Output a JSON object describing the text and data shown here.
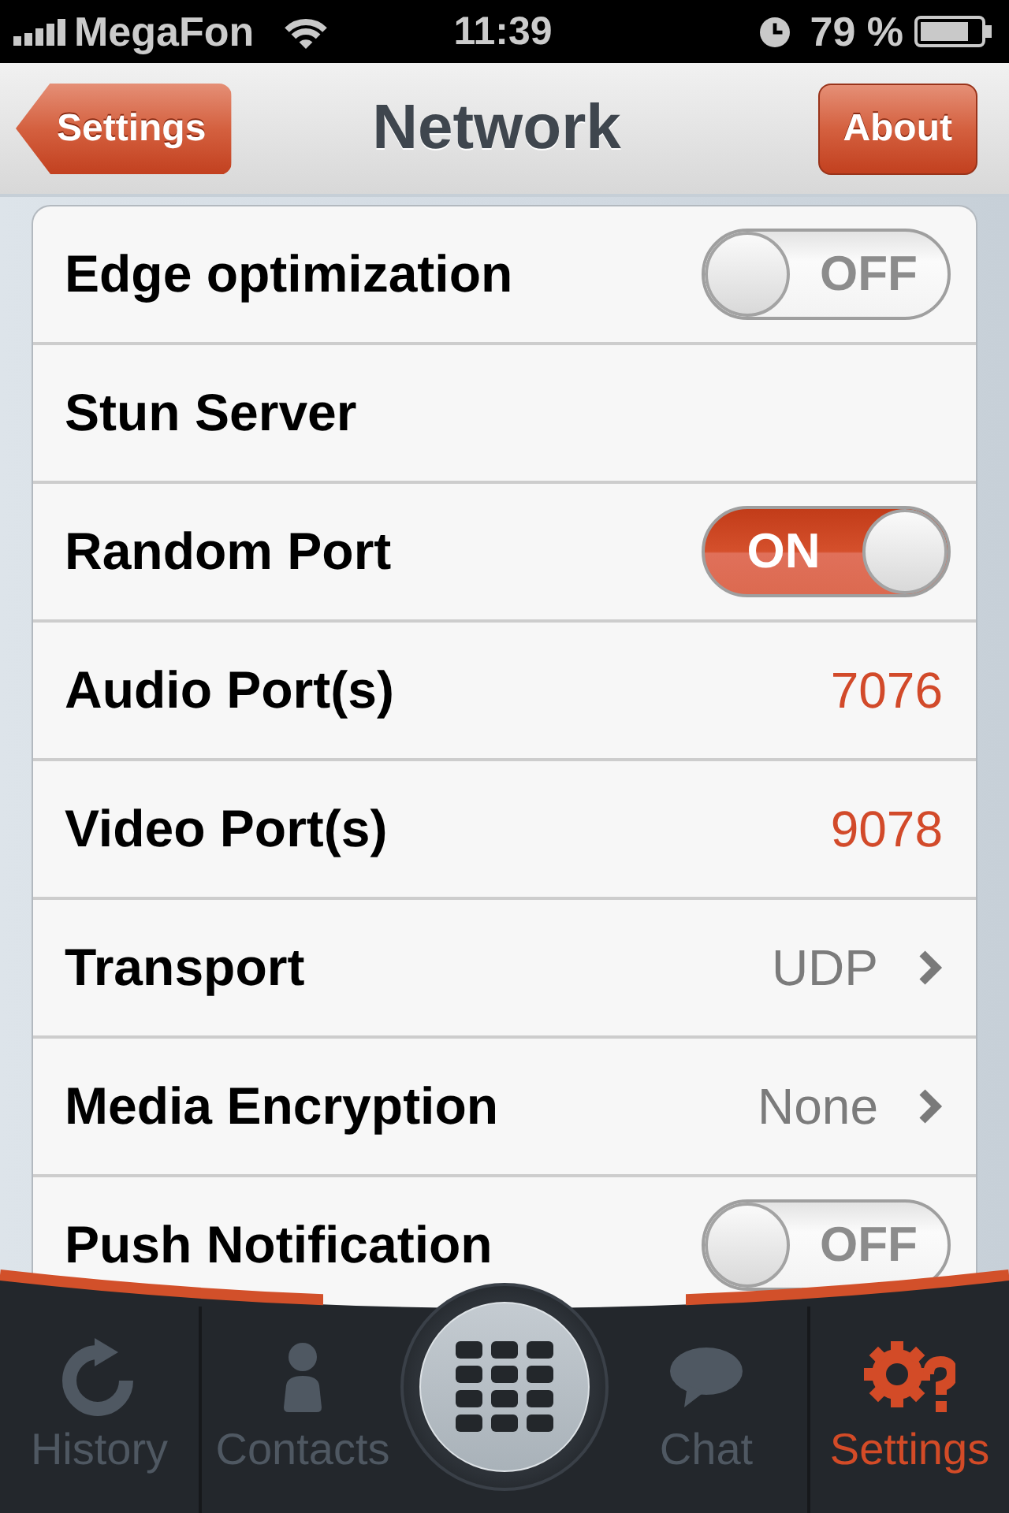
{
  "status_bar": {
    "carrier": "MegaFon",
    "time": "11:39",
    "battery": "79 %"
  },
  "nav_bar": {
    "back_button": "Settings",
    "title": "Network",
    "right_button": "About"
  },
  "rows": [
    {
      "kind": "toggle",
      "label": "Edge optimization",
      "on": false,
      "state_text": "OFF"
    },
    {
      "kind": "plain",
      "label": "Stun Server"
    },
    {
      "kind": "toggle",
      "label": "Random Port",
      "on": true,
      "state_text": "ON"
    },
    {
      "kind": "value",
      "label": "Audio Port(s)",
      "value": "7076"
    },
    {
      "kind": "value",
      "label": "Video Port(s)",
      "value": "9078"
    },
    {
      "kind": "disclosure",
      "label": "Transport",
      "value": "UDP"
    },
    {
      "kind": "disclosure",
      "label": "Media Encryption",
      "value": "None"
    },
    {
      "kind": "toggle",
      "label": "Push Notification",
      "on": false,
      "state_text": "OFF"
    }
  ],
  "tabs": [
    {
      "kind": "tab",
      "label": "History",
      "selected": false
    },
    {
      "kind": "tab",
      "label": "Contacts",
      "selected": false
    },
    {
      "kind": "dial",
      "selected": false
    },
    {
      "kind": "tab",
      "label": "Chat",
      "selected": false
    },
    {
      "kind": "tab",
      "label": "Settings",
      "selected": true
    }
  ]
}
